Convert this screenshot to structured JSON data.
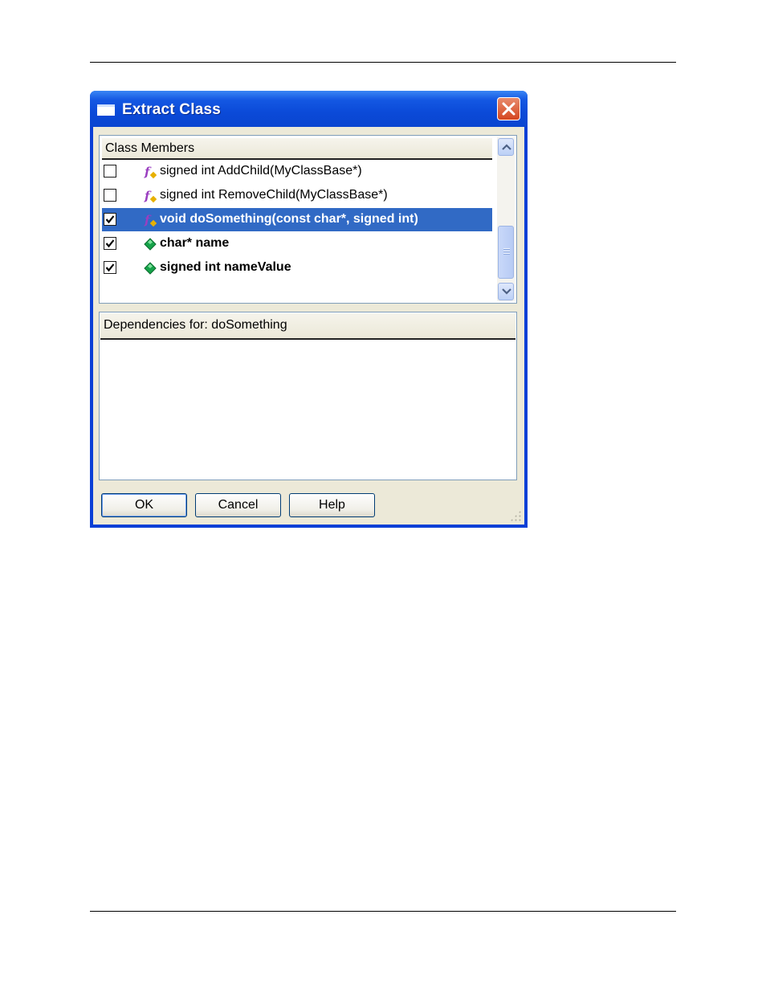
{
  "window": {
    "title": "Extract Class"
  },
  "members": {
    "header": "Class Members",
    "rows": [
      {
        "label": "signed int AddChild(MyClassBase*)",
        "checked": false,
        "icon": "function-icon",
        "bold": false,
        "selected": false
      },
      {
        "label": "signed int RemoveChild(MyClassBase*)",
        "checked": false,
        "icon": "function-icon",
        "bold": false,
        "selected": false
      },
      {
        "label": "void doSomething(const char*, signed int)",
        "checked": true,
        "icon": "function-icon",
        "bold": true,
        "selected": true
      },
      {
        "label": "char* name",
        "checked": true,
        "icon": "variable-icon",
        "bold": true,
        "selected": false
      },
      {
        "label": "signed int nameValue",
        "checked": true,
        "icon": "variable-icon",
        "bold": true,
        "selected": false
      }
    ]
  },
  "dependencies": {
    "header": "Dependencies for: doSomething"
  },
  "buttons": {
    "ok": "OK",
    "cancel": "Cancel",
    "help": "Help"
  },
  "colors": {
    "titlebar": "#0a45d0",
    "selection": "#316ac5",
    "function_icon": "#9a3fc0",
    "variable_icon": "#16a34a",
    "close": "#d5461f"
  }
}
